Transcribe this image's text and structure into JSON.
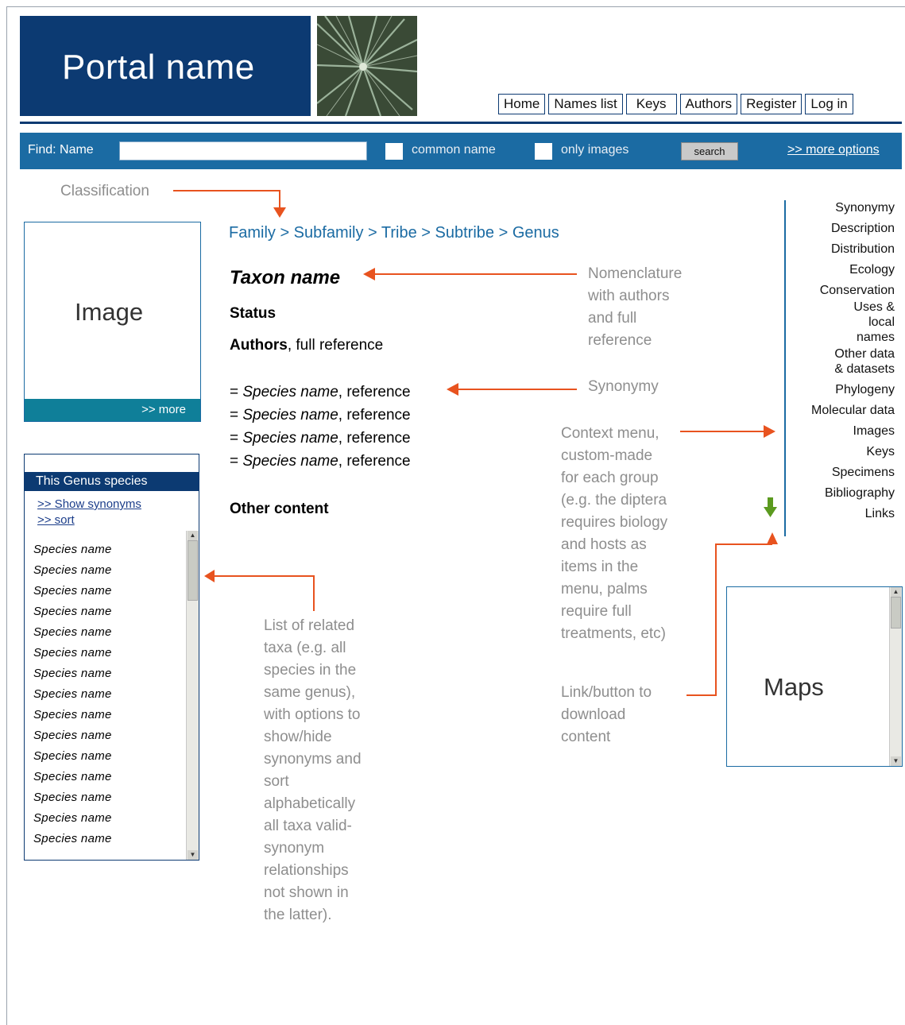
{
  "header": {
    "portal_name": "Portal name",
    "nav": [
      "Home",
      "Names list",
      "Keys",
      "Authors",
      "Register",
      "Log in"
    ]
  },
  "findbar": {
    "label": "Find:  Name",
    "input_value": "",
    "common_name_label": "common name",
    "only_images_label": "only images",
    "search_label": "search",
    "more_options": ">> more options"
  },
  "annotations": {
    "classification": "Classification",
    "nomenclature": [
      "Nomenclature",
      "with authors",
      "and full",
      "reference"
    ],
    "synonymy": "Synonymy",
    "context_menu": [
      "Context menu,",
      "custom-made",
      "for each group",
      "(e.g. the diptera",
      "requires biology",
      "and hosts as",
      "items in the",
      "menu, palms",
      "require full",
      "treatments, etc)"
    ],
    "download": [
      "Link/button to",
      "download",
      "content"
    ],
    "related_list": [
      "List of related",
      "taxa (e.g. all",
      "species in the",
      "same genus),",
      "with options to",
      "show/hide",
      "synonyms and",
      "sort",
      "alphabetically",
      "all taxa valid-",
      "synonym",
      "relationships",
      "not shown in",
      "the latter)."
    ]
  },
  "image_panel": {
    "label": "Image",
    "more": ">> more"
  },
  "species_list": {
    "title": "This Genus species",
    "show_synonyms": ">> Show synonyms",
    "sort": ">> sort",
    "items": [
      "Species name",
      "Species name",
      "Species name",
      "Species name",
      "Species name",
      "Species name",
      "Species name",
      "Species name",
      "Species name",
      "Species name",
      "Species name",
      "Species name",
      "Species name",
      "Species name",
      "Species name"
    ]
  },
  "main": {
    "breadcrumb": "Family > Subfamily > Tribe > Subtribe > Genus",
    "taxon_name": "Taxon name",
    "status": "Status",
    "authors_bold": "Authors",
    "authors_rest": ", full reference",
    "synonyms": [
      {
        "prefix": "= ",
        "name": "Species name",
        "ref": ", reference"
      },
      {
        "prefix": "= ",
        "name": "Species name",
        "ref": ", reference"
      },
      {
        "prefix": "= ",
        "name": "Species name",
        "ref": ", reference"
      },
      {
        "prefix": "= ",
        "name": "Species name",
        "ref": ", reference"
      }
    ],
    "other_content": "Other content"
  },
  "context_menu": [
    "Synonymy",
    "Description",
    "Distribution",
    "Ecology",
    "Conservation",
    "Uses & local names",
    "Other data & datasets",
    "Phylogeny",
    "Molecular data",
    "Images",
    "Keys",
    "Specimens",
    "Bibliography",
    "Links"
  ],
  "maps": {
    "label": "Maps"
  },
  "colors": {
    "brand_navy": "#0c3a72",
    "find_blue": "#1b6ba3",
    "annotation_arrow": "#e8531f",
    "link_blue": "#1b6ba3"
  },
  "icons": {
    "download": "green-down-arrow-icon"
  }
}
